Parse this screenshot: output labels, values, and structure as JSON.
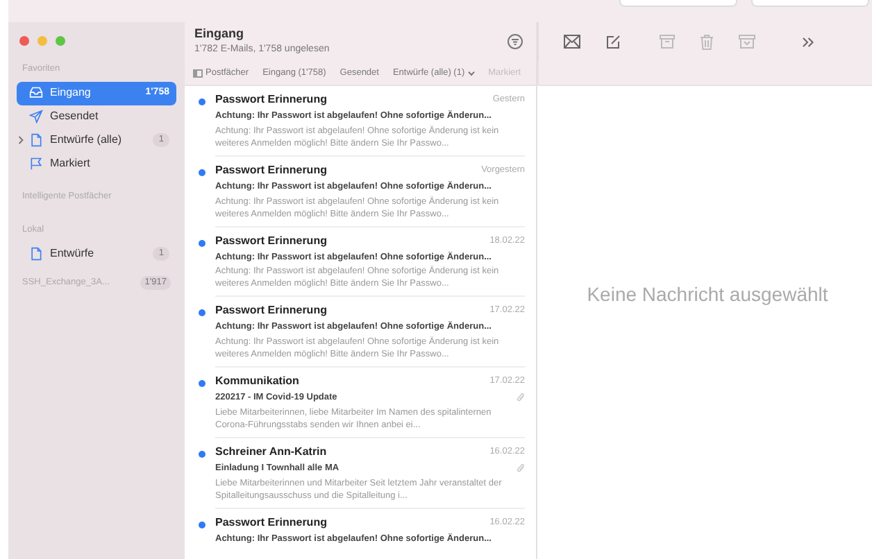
{
  "sidebar": {
    "sections": [
      {
        "title": "Favoriten",
        "items": [
          {
            "label": "Eingang",
            "kind": "inbox",
            "count": "1'758",
            "selected": true,
            "expandable": false
          },
          {
            "label": "Gesendet",
            "kind": "sent",
            "selected": false,
            "expandable": false
          },
          {
            "label": "Entwürfe (alle)",
            "kind": "doc",
            "count": "1",
            "selected": false,
            "expandable": true
          },
          {
            "label": "Markiert",
            "kind": "flag",
            "selected": false,
            "expandable": false
          }
        ]
      },
      {
        "title": "Intelligente Postfächer"
      },
      {
        "title": "Lokal",
        "items": [
          {
            "label": "Entwürfe",
            "kind": "doc",
            "count": "1",
            "selected": false,
            "expandable": false
          }
        ]
      }
    ],
    "account": {
      "label": "SSH_Exchange_3A...",
      "count": "1'917"
    }
  },
  "mailbox": {
    "title": "Eingang",
    "subtitle": "1'782 E-Mails, 1'758 ungelesen"
  },
  "favorites_bar": [
    {
      "label": "Postfächer",
      "kind": "sidebar",
      "disabled": false
    },
    {
      "label": "Eingang (1'758)",
      "kind": "plain",
      "disabled": false
    },
    {
      "label": "Gesendet",
      "kind": "plain",
      "disabled": false
    },
    {
      "label": "Entwürfe (alle) (1)",
      "kind": "menu",
      "disabled": false
    },
    {
      "label": "Markiert",
      "kind": "plain",
      "disabled": true
    }
  ],
  "messages": [
    {
      "sender": "Passwort Erinnerung",
      "date": "Gestern",
      "subject": "Achtung: Ihr Passwort ist abgelaufen! Ohne sofortige Änderun...",
      "preview": "Achtung: Ihr Passwort ist abgelaufen! Ohne sofortige Änderung ist kein weiteres Anmelden möglich! Bitte ändern Sie Ihr Passwo...",
      "unread": true,
      "attachment": false
    },
    {
      "sender": "Passwort Erinnerung",
      "date": "Vorgestern",
      "subject": "Achtung: Ihr Passwort ist abgelaufen! Ohne sofortige Änderun...",
      "preview": "Achtung: Ihr Passwort ist abgelaufen! Ohne sofortige Änderung ist kein weiteres Anmelden möglich! Bitte ändern Sie Ihr Passwo...",
      "unread": true,
      "attachment": false
    },
    {
      "sender": "Passwort Erinnerung",
      "date": "18.02.22",
      "subject": "Achtung: Ihr Passwort ist abgelaufen! Ohne sofortige Änderun...",
      "preview": "Achtung: Ihr Passwort ist abgelaufen! Ohne sofortige Änderung ist kein weiteres Anmelden möglich! Bitte ändern Sie Ihr Passwo...",
      "unread": true,
      "attachment": false
    },
    {
      "sender": "Passwort Erinnerung",
      "date": "17.02.22",
      "subject": "Achtung: Ihr Passwort ist abgelaufen! Ohne sofortige Änderun...",
      "preview": "Achtung: Ihr Passwort ist abgelaufen! Ohne sofortige Änderung ist kein weiteres Anmelden möglich! Bitte ändern Sie Ihr Passwo...",
      "unread": true,
      "attachment": false
    },
    {
      "sender": "Kommunikation",
      "date": "17.02.22",
      "subject": "220217 - IM Covid-19 Update",
      "preview": "Liebe Mitarbeiterinnen, liebe Mitarbeiter Im Namen des spitalinternen Corona-Führungsstabs senden wir Ihnen anbei ei...",
      "unread": true,
      "attachment": true
    },
    {
      "sender": "Schreiner Ann-Katrin",
      "date": "16.02.22",
      "subject": "Einladung I Townhall alle MA",
      "preview": "Liebe Mitarbeiterinnen und Mitarbeiter Seit letztem Jahr veranstaltet der Spitalleitungsausschuss und die Spitalleitung i...",
      "unread": true,
      "attachment": true
    },
    {
      "sender": "Passwort Erinnerung",
      "date": "16.02.22",
      "subject": "Achtung: Ihr Passwort ist abgelaufen! Ohne sofortige Änderun...",
      "unread": true,
      "attachment": false
    }
  ],
  "reading_pane": {
    "empty_text": "Keine Nachricht ausgewählt"
  }
}
